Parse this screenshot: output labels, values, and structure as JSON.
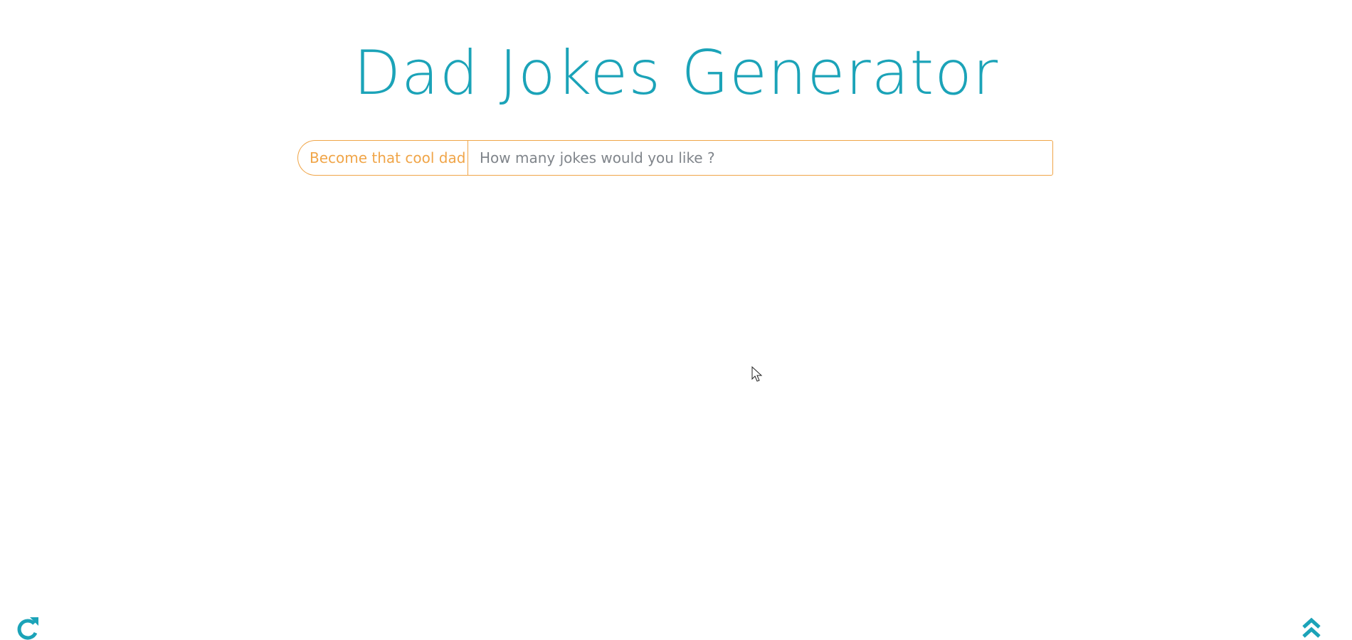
{
  "header": {
    "title": "Dad Jokes Generator"
  },
  "jokes_form": {
    "prefix_label": "Become that cool dad",
    "count_input": {
      "value": "",
      "placeholder": "How many jokes would you like ?"
    }
  },
  "footer": {
    "refresh_icon": "refresh-icon",
    "top_icon": "double-chevron-up-icon"
  },
  "colors": {
    "title": "#1ba3b8",
    "accent": "#f0a548",
    "placeholder": "#80858b",
    "icon": "#1ba3b8"
  }
}
